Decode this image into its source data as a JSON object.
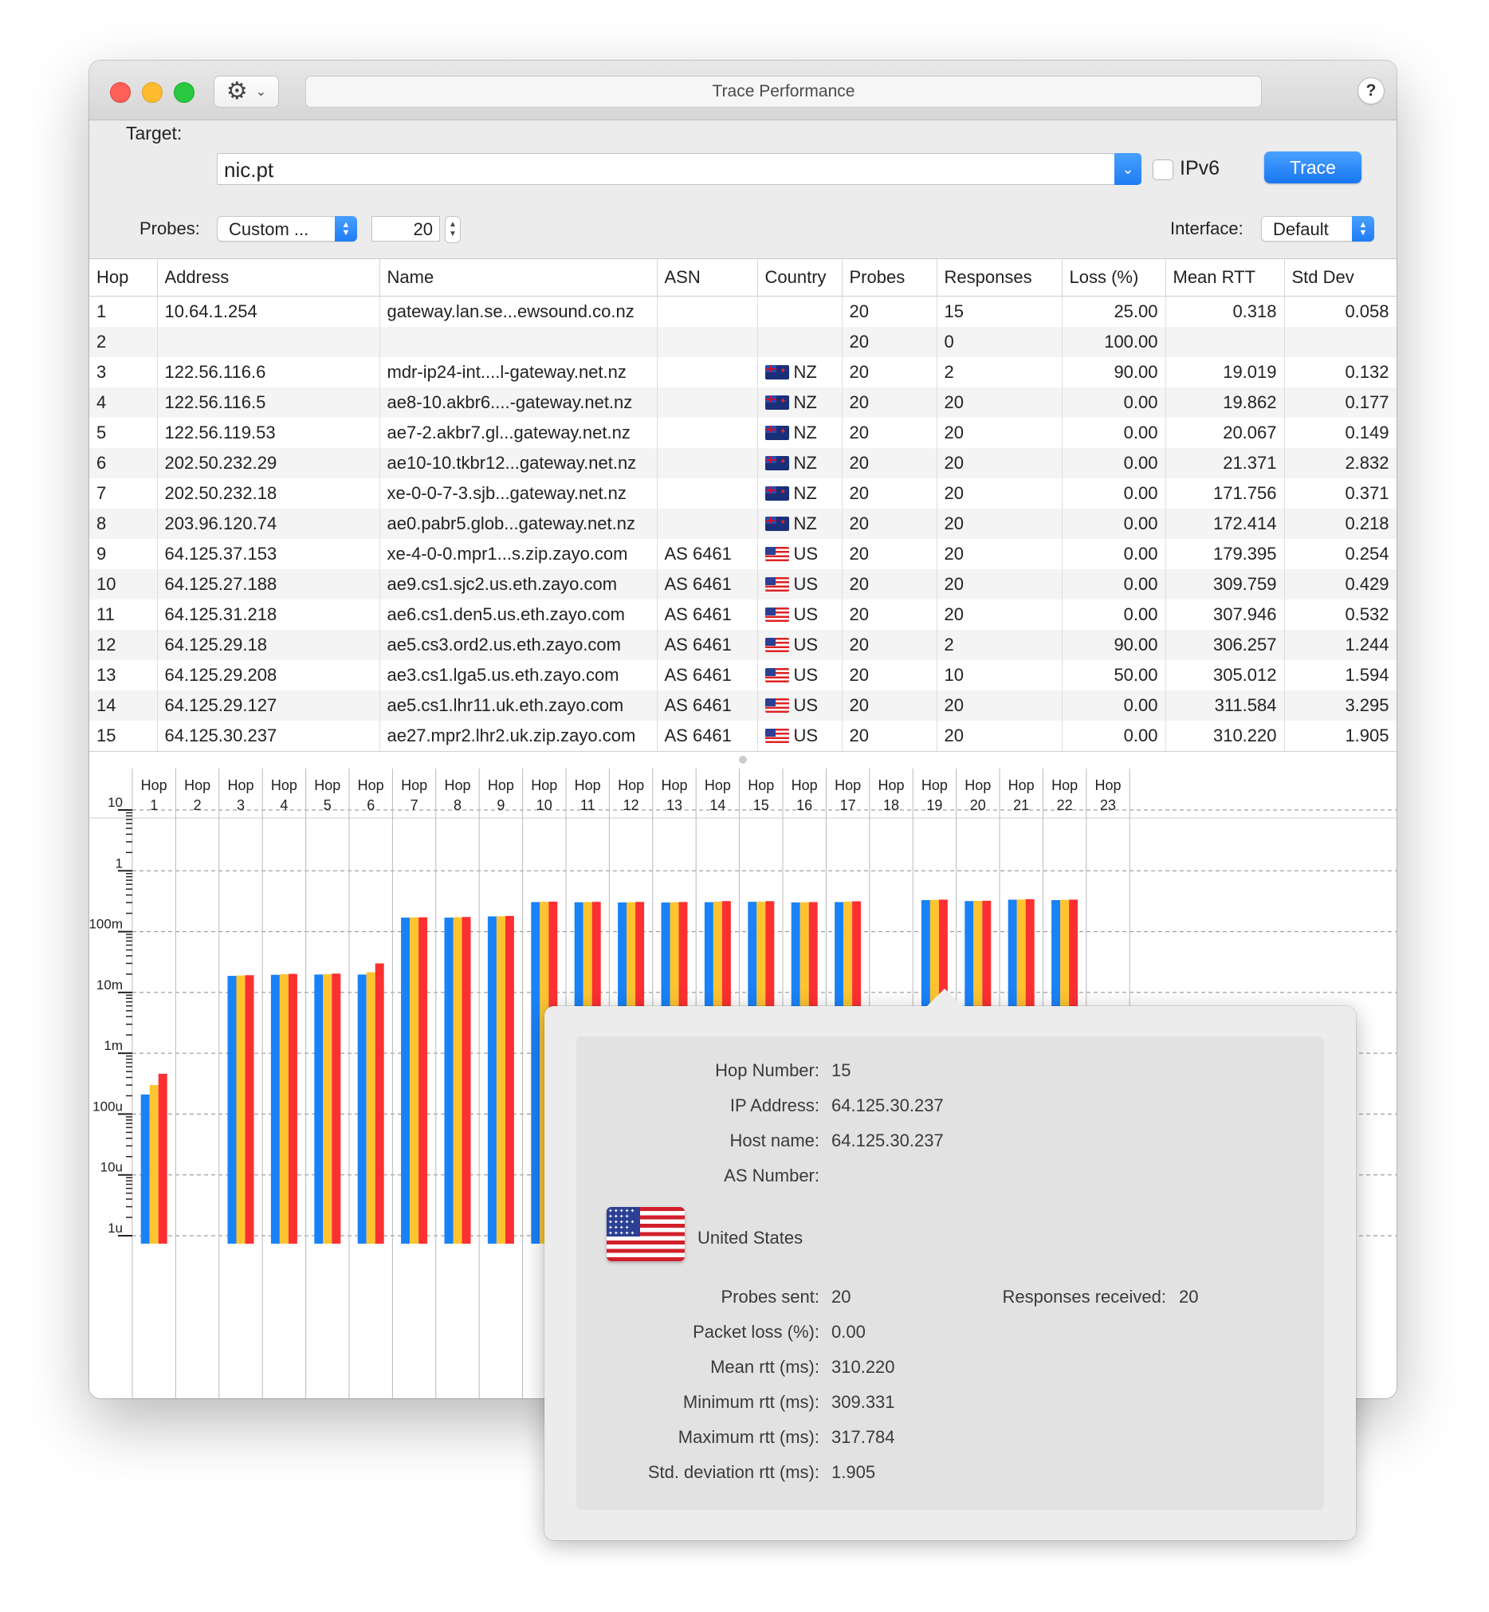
{
  "window": {
    "title": "Trace Performance",
    "help_label": "?"
  },
  "toolbar": {
    "gear_icon": "gear-icon",
    "chevron": "⌄"
  },
  "form": {
    "target_label": "Target:",
    "target_value": "nic.pt",
    "ipv6_label": "IPv6",
    "ipv6_checked": false,
    "trace_label": "Trace",
    "probes_label": "Probes:",
    "probes_mode": "Custom ...",
    "probes_count": "20",
    "interface_label": "Interface:",
    "interface_value": "Default"
  },
  "table": {
    "columns": [
      "Hop",
      "Address",
      "Name",
      "ASN",
      "Country",
      "Probes",
      "Responses",
      "Loss (%)",
      "Mean RTT",
      "Std Dev"
    ],
    "rows": [
      [
        "1",
        "10.64.1.254",
        "gateway.lan.se...ewsound.co.nz",
        "",
        "",
        "20",
        "15",
        "25.00",
        "0.318",
        "0.058"
      ],
      [
        "2",
        "",
        "",
        "",
        "",
        "20",
        "0",
        "100.00",
        "",
        ""
      ],
      [
        "3",
        "122.56.116.6",
        "mdr-ip24-int....l-gateway.net.nz",
        "",
        "NZ",
        "20",
        "2",
        "90.00",
        "19.019",
        "0.132"
      ],
      [
        "4",
        "122.56.116.5",
        "ae8-10.akbr6....-gateway.net.nz",
        "",
        "NZ",
        "20",
        "20",
        "0.00",
        "19.862",
        "0.177"
      ],
      [
        "5",
        "122.56.119.53",
        "ae7-2.akbr7.gl...gateway.net.nz",
        "",
        "NZ",
        "20",
        "20",
        "0.00",
        "20.067",
        "0.149"
      ],
      [
        "6",
        "202.50.232.29",
        "ae10-10.tkbr12...gateway.net.nz",
        "",
        "NZ",
        "20",
        "20",
        "0.00",
        "21.371",
        "2.832"
      ],
      [
        "7",
        "202.50.232.18",
        "xe-0-0-7-3.sjb...gateway.net.nz",
        "",
        "NZ",
        "20",
        "20",
        "0.00",
        "171.756",
        "0.371"
      ],
      [
        "8",
        "203.96.120.74",
        "ae0.pabr5.glob...gateway.net.nz",
        "",
        "NZ",
        "20",
        "20",
        "0.00",
        "172.414",
        "0.218"
      ],
      [
        "9",
        "64.125.37.153",
        "xe-4-0-0.mpr1...s.zip.zayo.com",
        "AS 6461",
        "US",
        "20",
        "20",
        "0.00",
        "179.395",
        "0.254"
      ],
      [
        "10",
        "64.125.27.188",
        "ae9.cs1.sjc2.us.eth.zayo.com",
        "AS 6461",
        "US",
        "20",
        "20",
        "0.00",
        "309.759",
        "0.429"
      ],
      [
        "11",
        "64.125.31.218",
        "ae6.cs1.den5.us.eth.zayo.com",
        "AS 6461",
        "US",
        "20",
        "20",
        "0.00",
        "307.946",
        "0.532"
      ],
      [
        "12",
        "64.125.29.18",
        "ae5.cs3.ord2.us.eth.zayo.com",
        "AS 6461",
        "US",
        "20",
        "2",
        "90.00",
        "306.257",
        "1.244"
      ],
      [
        "13",
        "64.125.29.208",
        "ae3.cs1.lga5.us.eth.zayo.com",
        "AS 6461",
        "US",
        "20",
        "10",
        "50.00",
        "305.012",
        "1.594"
      ],
      [
        "14",
        "64.125.29.127",
        "ae5.cs1.lhr11.uk.eth.zayo.com",
        "AS 6461",
        "US",
        "20",
        "20",
        "0.00",
        "311.584",
        "3.295"
      ],
      [
        "15",
        "64.125.30.237",
        "ae27.mpr2.lhr2.uk.zip.zayo.com",
        "AS 6461",
        "US",
        "20",
        "20",
        "0.00",
        "310.220",
        "1.905"
      ]
    ]
  },
  "chart_data": {
    "type": "bar",
    "yscale": "log",
    "ylim": [
      1e-06,
      10
    ],
    "ytick_labels": [
      "10",
      "1",
      "100m",
      "10m",
      "1m",
      "100u",
      "10u",
      "1u"
    ],
    "grid": true,
    "categories": [
      "Hop 1",
      "Hop 2",
      "Hop 3",
      "Hop 4",
      "Hop 5",
      "Hop 6",
      "Hop 7",
      "Hop 8",
      "Hop 9",
      "Hop 10",
      "Hop 11",
      "Hop 12",
      "Hop 13",
      "Hop 14",
      "Hop 15",
      "Hop 16",
      "Hop 17",
      "Hop 18",
      "Hop 19",
      "Hop 20",
      "Hop 21",
      "Hop 22",
      "Hop 23"
    ],
    "colors": [
      "#1a82f7",
      "#fdc430",
      "#fc3031"
    ],
    "series": [
      {
        "values": [
          0.00021,
          null,
          0.0187,
          0.0195,
          0.0197,
          0.0197,
          0.17,
          0.17,
          0.178,
          0.306,
          0.304,
          0.302,
          0.301,
          0.305,
          0.309,
          0.302,
          0.306,
          null,
          0.33,
          0.318,
          0.335,
          0.33,
          null
        ]
      },
      {
        "values": [
          0.0003,
          null,
          0.019,
          0.0199,
          0.02,
          0.0215,
          0.171,
          0.172,
          0.179,
          0.309,
          0.307,
          0.305,
          0.304,
          0.31,
          0.31,
          0.304,
          0.31,
          null,
          0.333,
          0.32,
          0.338,
          0.333,
          null
        ]
      },
      {
        "values": [
          0.00046,
          null,
          0.0192,
          0.0202,
          0.0204,
          0.03,
          0.172,
          0.174,
          0.181,
          0.311,
          0.309,
          0.308,
          0.307,
          0.318,
          0.317,
          0.306,
          0.315,
          null,
          0.336,
          0.322,
          0.341,
          0.336,
          null
        ]
      }
    ]
  },
  "popover": {
    "hop_number_label": "Hop Number:",
    "hop_number": "15",
    "ip_label": "IP Address:",
    "ip": "64.125.30.237",
    "host_label": "Host name:",
    "host": "64.125.30.237",
    "as_label": "AS Number:",
    "as": "",
    "country": "United States",
    "probes_sent_label": "Probes sent:",
    "probes_sent": "20",
    "responses_label": "Responses received:",
    "responses": "20",
    "loss_label": "Packet loss (%):",
    "loss": "0.00",
    "mean_label": "Mean rtt (ms):",
    "mean": "310.220",
    "min_label": "Minimum rtt (ms):",
    "min": "309.331",
    "max_label": "Maximum rtt (ms):",
    "max": "317.784",
    "std_label": "Std. deviation rtt (ms):",
    "std": "1.905"
  }
}
